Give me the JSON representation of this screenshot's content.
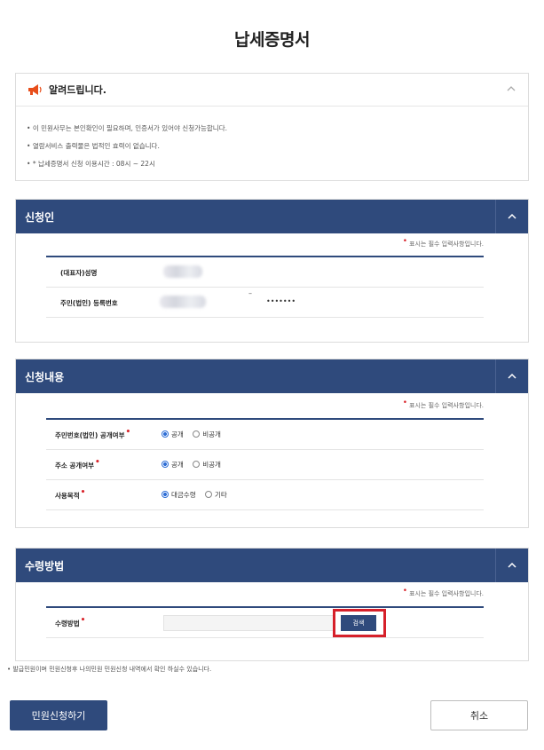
{
  "page": {
    "title": "납세증명서"
  },
  "notice": {
    "title": "알려드립니다.",
    "items": [
      "이 민원사무는 본인확인이 필요하며, 인증서가 있어야 신청가능합니다.",
      "열람서비스 출력물은 법적인 효력이 없습니다.",
      "* 납세증명서 신청 이용시간 : 08시 ~ 22시"
    ]
  },
  "applicant": {
    "title": "신청인",
    "required_note": "표시는 필수 입력사항입니다.",
    "name_label": "(대표자)성명",
    "id_label": "주민(법인) 등록번호",
    "id_masked": "•••••••"
  },
  "request": {
    "title": "신청내용",
    "required_note": "표시는 필수 입력사항입니다.",
    "rows": [
      {
        "label": "주민번호(법인) 공개여부",
        "options": [
          "공개",
          "비공개"
        ],
        "selected": "공개"
      },
      {
        "label": "주소 공개여부",
        "options": [
          "공개",
          "비공개"
        ],
        "selected": "공개"
      },
      {
        "label": "사용목적",
        "options": [
          "대금수령",
          "기타"
        ],
        "selected": "대금수령"
      }
    ]
  },
  "receipt": {
    "title": "수령방법",
    "required_note": "표시는 필수 입력사항입니다.",
    "method_label": "수령방법",
    "search_label": "검색"
  },
  "footnote": "발급민원이며 민원신청후 나의민원 민원신청 내역에서 확인 하실수 있습니다.",
  "actions": {
    "submit_label": "민원신청하기",
    "cancel_label": "취소"
  },
  "colors": {
    "header": "#2f4a7c",
    "required": "#d9232a",
    "highlight": "#d6202a",
    "radio": "#2f6fd6"
  }
}
